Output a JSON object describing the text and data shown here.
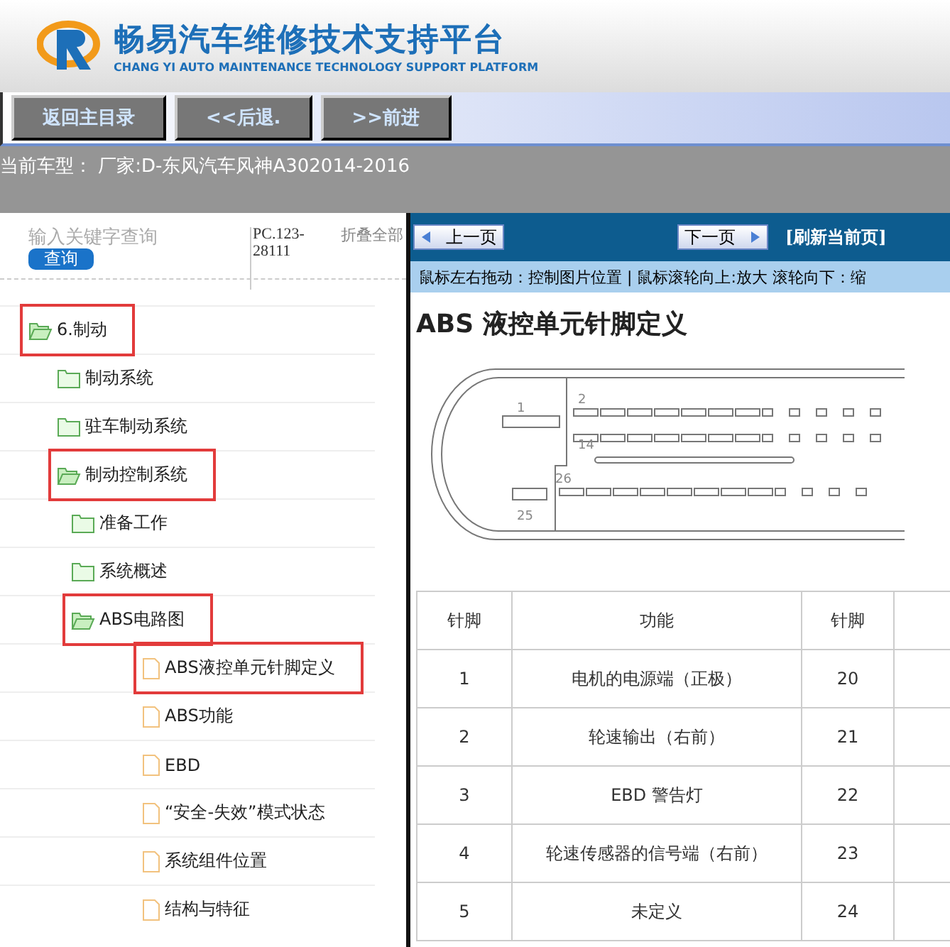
{
  "header": {
    "title": "畅易汽车维修技术支持平台",
    "subtitle": "CHANG YI AUTO MAINTENANCE TECHNOLOGY SUPPORT PLATFORM"
  },
  "nav_buttons": [
    "返回主目录",
    "<<后退.",
    ">>前进"
  ],
  "car_model": "当前车型： 厂家:D-东风汽车风神A302014-2016",
  "search": {
    "placeholder": "输入关键字查询",
    "button": "查询",
    "code": "PC.123-28111",
    "collapse": "折叠全部"
  },
  "tree": [
    {
      "label": "6.制动",
      "kind": "folder",
      "expanded": true,
      "marked": true,
      "children": [
        {
          "label": "制动系统",
          "kind": "folder",
          "expanded": false,
          "marked": false
        },
        {
          "label": "驻车制动系统",
          "kind": "folder",
          "expanded": false,
          "marked": false
        },
        {
          "label": "制动控制系统",
          "kind": "folder",
          "expanded": true,
          "marked": true,
          "children": [
            {
              "label": "准备工作",
              "kind": "folder",
              "expanded": false,
              "marked": false
            },
            {
              "label": "系统概述",
              "kind": "folder",
              "expanded": false,
              "marked": false
            },
            {
              "label": "ABS电路图",
              "kind": "folder",
              "expanded": true,
              "marked": true,
              "children": [
                {
                  "label": "ABS液控单元针脚定义",
                  "kind": "page",
                  "marked": true
                },
                {
                  "label": "ABS功能",
                  "kind": "page",
                  "marked": false
                },
                {
                  "label": "EBD",
                  "kind": "page",
                  "marked": false
                },
                {
                  "label": "“安全-失效”模式状态",
                  "kind": "page",
                  "marked": false
                },
                {
                  "label": "系统组件位置",
                  "kind": "page",
                  "marked": false
                },
                {
                  "label": "结构与特征",
                  "kind": "page",
                  "marked": false
                }
              ]
            }
          ]
        }
      ]
    }
  ],
  "viewer": {
    "prev": "上一页",
    "next": "下一页",
    "refresh": "[刷新当前页]",
    "hint": "鼠标左右拖动：控制图片位置 | 鼠标滚轮向上:放大  滚轮向下：缩",
    "title": "ABS 液控单元针脚定义",
    "connector_labels": [
      "1",
      "2",
      "14",
      "26",
      "25"
    ],
    "table": {
      "columns": [
        "针脚",
        "功能",
        "针脚",
        ""
      ],
      "rows": [
        [
          "1",
          "电机的电源端（正极）",
          "20"
        ],
        [
          "2",
          "轮速输出（右前）",
          "21"
        ],
        [
          "3",
          "EBD 警告灯",
          "22"
        ],
        [
          "4",
          "轮速传感器的信号端（右前）",
          "23"
        ],
        [
          "5",
          "未定义",
          "24"
        ]
      ]
    }
  }
}
